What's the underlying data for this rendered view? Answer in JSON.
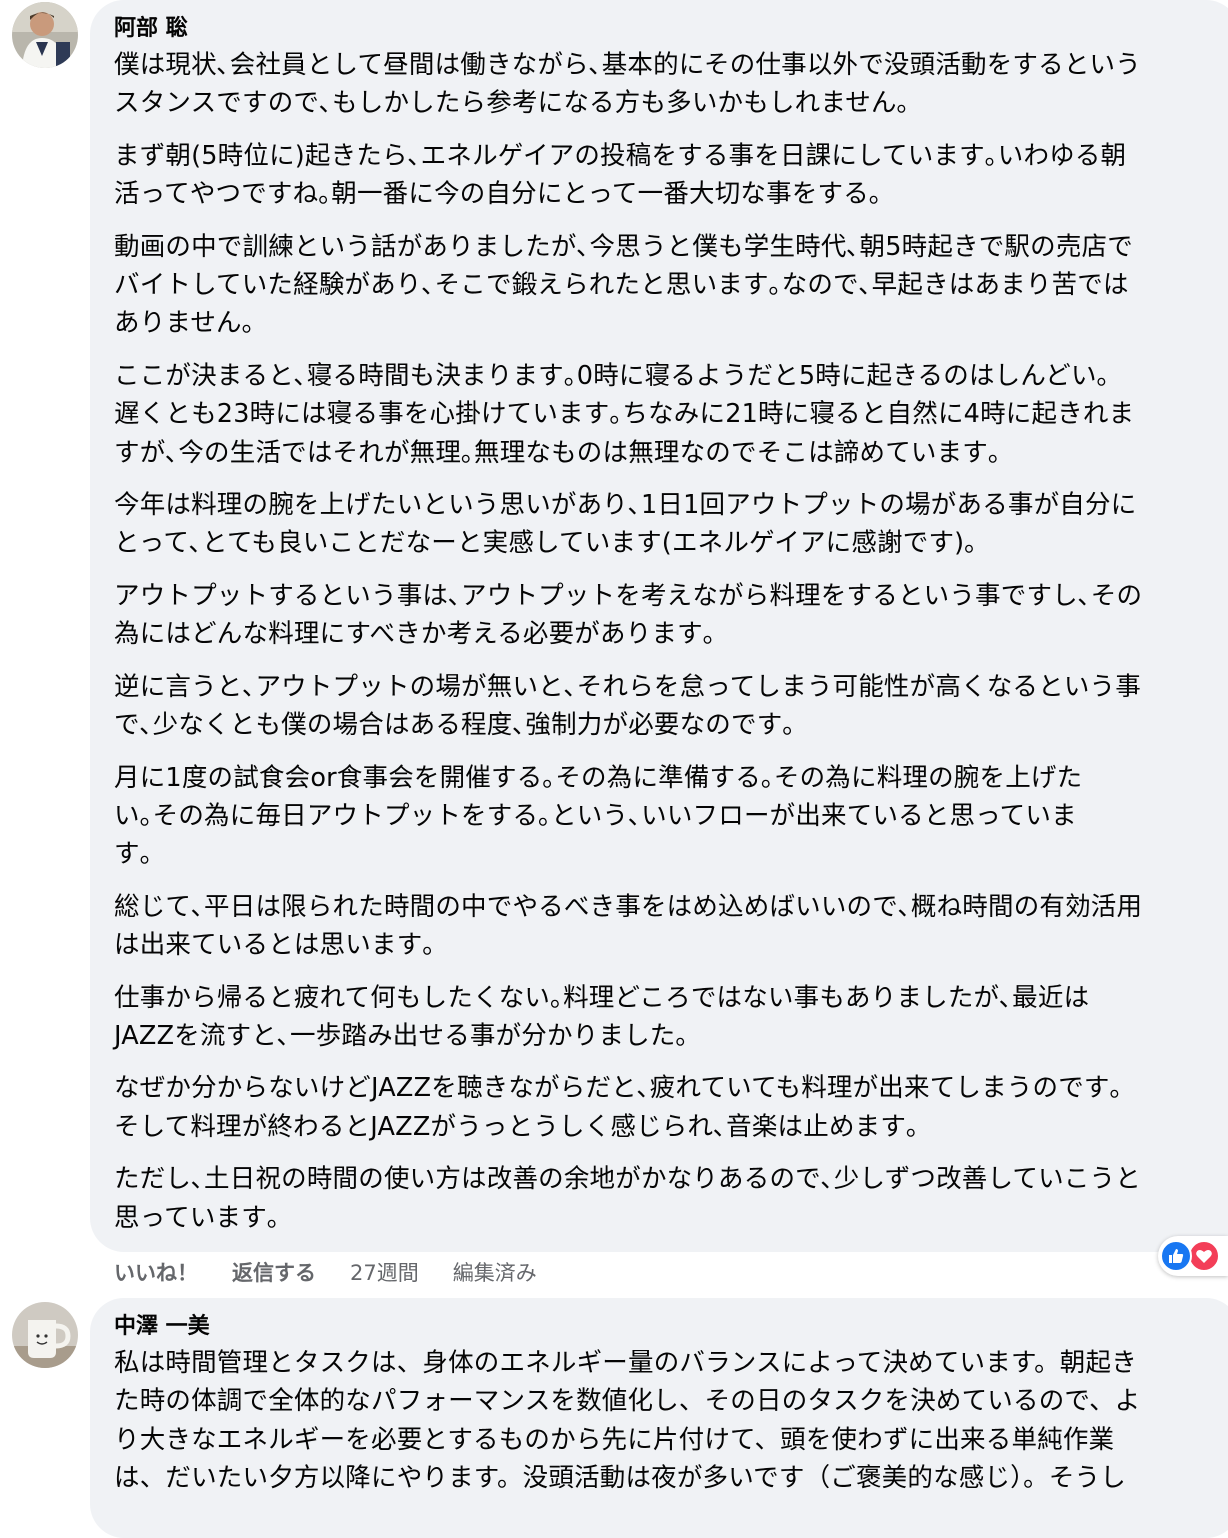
{
  "comments": [
    {
      "author": "阿部 聡",
      "paragraphs": [
        "僕は現状､会社員として昼間は働きながら､基本的にその仕事以外で没頭活動をするという\nスタンスですので､もしかしたら参考になる方も多いかもしれません｡",
        "まず朝(5時位に)起きたら､エネルゲイアの投稿をする事を日課にしています｡いわゆる朝\n活ってやつですね｡朝一番に今の自分にとって一番大切な事をする｡",
        "動画の中で訓練という話がありましたが､今思うと僕も学生時代､朝5時起きで駅の売店で\nバイトしていた経験があり､そこで鍛えられたと思います｡なので､早起きはあまり苦では\nありません｡",
        "ここが決まると､寝る時間も決まります｡0時に寝るようだと5時に起きるのはしんどい｡\n遅くとも23時には寝る事を心掛けています｡ちなみに21時に寝ると自然に4時に起きれま\nすが､今の生活ではそれが無理｡無理なものは無理なのでそこは諦めています｡",
        "今年は料理の腕を上げたいという思いがあり､1日1回アウトプットの場がある事が自分に\nとって､とても良いことだなーと実感しています(エネルゲイアに感謝です)｡",
        "アウトプットするという事は､アウトプットを考えながら料理をするという事ですし､その\n為にはどんな料理にすべきか考える必要があります｡",
        "逆に言うと､アウトプットの場が無いと､それらを怠ってしまう可能性が高くなるという事\nで､少なくとも僕の場合はある程度､強制力が必要なのです｡",
        "月に1度の試食会or食事会を開催する｡その為に準備する｡その為に料理の腕を上げた\nい｡その為に毎日アウトプットをする｡という､いいフローが出来ていると思っていま\nす｡",
        "総じて､平日は限られた時間の中でやるべき事をはめ込めばいいので､概ね時間の有効活用\nは出来ているとは思います｡",
        "仕事から帰ると疲れて何もしたくない｡料理どころではない事もありましたが､最近は\nJAZZを流すと､一歩踏み出せる事が分かりました｡",
        "なぜか分からないけどJAZZを聴きながらだと､疲れていても料理が出来てしまうのです｡\nそして料理が終わるとJAZZがうっとうしく感じられ､音楽は止めます｡",
        "ただし､土日祝の時間の使い方は改善の余地がかなりあるので､少しずつ改善していこうと\n思っています｡"
      ],
      "actions": {
        "like": "いいね！",
        "reply": "返信する",
        "time": "27週間",
        "edited": "編集済み"
      },
      "reactions": [
        "like-icon",
        "love-icon"
      ]
    },
    {
      "author": "中澤 一美",
      "paragraphs": [
        "私は時間管理とタスクは、身体のエネルギー量のバランスによって決めています。朝起き\nた時の体調で全体的なパフォーマンスを数値化し、その日のタスクを決めているので、よ\nり大きなエネルギーを必要とするものから先に片付けて、頭を使わずに出来る単純作業\nは、だいたい夕方以降にやります。没頭活動は夜が多いです（ご褒美的な感じ）。そうし"
      ]
    }
  ],
  "colors": {
    "bubble": "#f0f2f5",
    "meta": "#65676b",
    "like": "#1877f2",
    "love": "#f33e58"
  }
}
